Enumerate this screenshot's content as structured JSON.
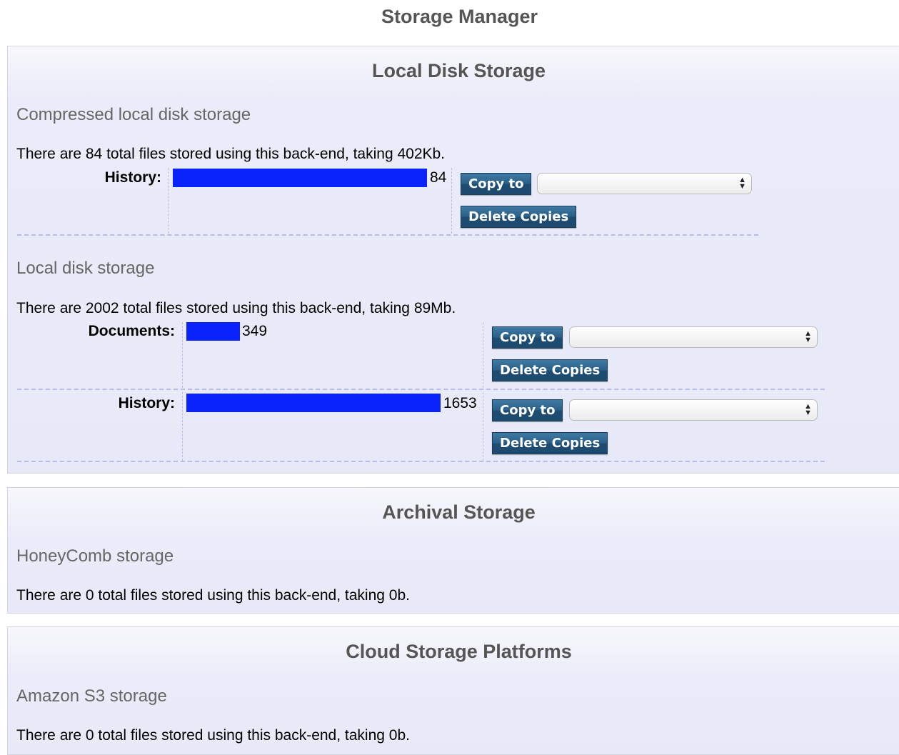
{
  "page_title": "Storage Manager",
  "colors": {
    "bar": "#0a22fb",
    "button": "#2a5f86",
    "panel": "#e8e9f8"
  },
  "icons": {
    "select_arrows": "up-down-arrows-icon"
  },
  "copy_to_select_value": "",
  "sections": {
    "local": {
      "title": "Local Disk Storage",
      "backends": {
        "compressed": {
          "title": "Compressed local disk storage",
          "summary": "There are 84 total files stored using this back-end, taking 402Kb.",
          "categories": {
            "history": {
              "label": "History:",
              "count": "84",
              "copy_label": "Copy to",
              "delete_label": "Delete Copies",
              "fill_fraction": 1.0
            }
          }
        },
        "disk": {
          "title": "Local disk storage",
          "summary": "There are 2002 total files stored using this back-end, taking 89Mb.",
          "categories": {
            "documents": {
              "label": "Documents:",
              "count": "349",
              "copy_label": "Copy to",
              "delete_label": "Delete Copies",
              "fill_fraction": 0.211
            },
            "history": {
              "label": "History:",
              "count": "1653",
              "copy_label": "Copy to",
              "delete_label": "Delete Copies",
              "fill_fraction": 1.0
            }
          }
        }
      }
    },
    "archival": {
      "title": "Archival Storage",
      "backends": {
        "honeycomb": {
          "title": "HoneyComb storage",
          "summary": "There are 0 total files stored using this back-end, taking 0b."
        }
      }
    },
    "cloud": {
      "title": "Cloud Storage Platforms",
      "backends": {
        "s3": {
          "title": "Amazon S3 storage",
          "summary": "There are 0 total files stored using this back-end, taking 0b."
        }
      }
    }
  }
}
